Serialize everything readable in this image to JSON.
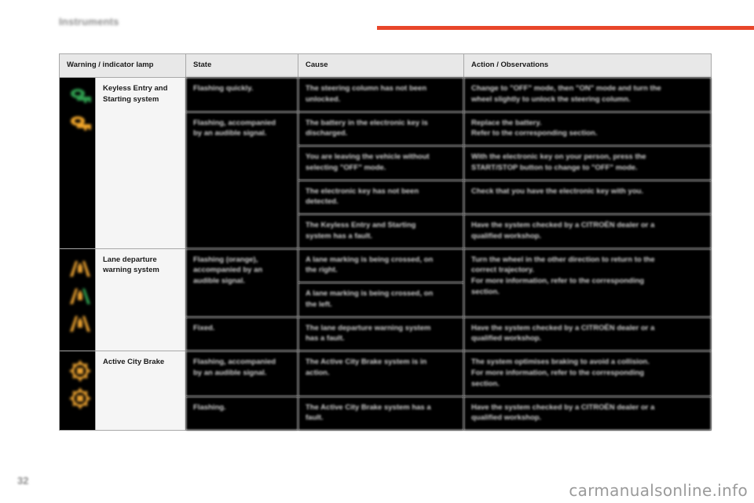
{
  "header": {
    "title": "Instruments",
    "accent_color": "#e8462a"
  },
  "footer": {
    "page_number": "32",
    "watermark": "carmanualsonline.info"
  },
  "table": {
    "columns": [
      "Warning / indicator lamp",
      "State",
      "Cause",
      "Action / Observations"
    ],
    "groups": [
      {
        "lamp": "Keyless Entry and Starting system",
        "icons": [
          "key-lamp-green-icon",
          "key-lamp-orange-icon"
        ],
        "rows": [
          {
            "state": [
              "Flashing quickly."
            ],
            "cause": [
              "The steering column has not been",
              "unlocked."
            ],
            "action": [
              "Change to \"OFF\" mode, then \"ON\" mode and turn the",
              "wheel slightly to unlock the steering column."
            ]
          },
          {
            "state": [
              "Flashing, accompanied",
              "by an audible signal."
            ],
            "cause": [
              "The battery in the electronic key is",
              "discharged."
            ],
            "action": [
              "Replace the battery.",
              "Refer to the corresponding section."
            ]
          },
          {
            "state": [],
            "cause": [
              "You are leaving the vehicle without",
              "selecting \"OFF\" mode."
            ],
            "action": [
              "With the electronic key on your person, press the",
              "START/STOP button to change to \"OFF\" mode."
            ]
          },
          {
            "state": [],
            "cause": [
              "The electronic key has not been",
              "detected."
            ],
            "action": [
              "Check that you have the electronic key with you."
            ]
          },
          {
            "state": [],
            "cause": [
              "The Keyless Entry and Starting",
              "system has a fault."
            ],
            "action": [
              "Have the system checked by a CITROËN dealer or a",
              "qualified workshop."
            ]
          }
        ]
      },
      {
        "lamp": "Lane departure warning system",
        "icons": [
          "lane-departure-lamp-1-icon",
          "lane-departure-lamp-2-icon",
          "lane-departure-lamp-3-icon"
        ],
        "rows": [
          {
            "state": [
              "Flashing (orange),",
              "accompanied by an",
              "audible signal."
            ],
            "cause": [
              "A lane marking is being crossed, on",
              "the right."
            ],
            "action": [
              "Turn the wheel in the other direction to return to the",
              "correct trajectory.",
              "For more information, refer to the corresponding",
              "section."
            ]
          },
          {
            "state": [],
            "cause": [
              "A lane marking is being crossed, on",
              "the left."
            ],
            "action": []
          },
          {
            "state": [
              "Fixed."
            ],
            "cause": [
              "The lane departure warning system",
              "has a fault."
            ],
            "action": [
              "Have the system checked by a CITROËN dealer or a",
              "qualified workshop."
            ]
          }
        ]
      },
      {
        "lamp": "Active City Brake",
        "icons": [
          "active-city-brake-lamp-1-icon",
          "active-city-brake-lamp-2-icon"
        ],
        "rows": [
          {
            "state": [
              "Flashing, accompanied",
              "by an audible signal."
            ],
            "cause": [
              "The Active City Brake system is in",
              "action."
            ],
            "action": [
              "The system optimises braking to avoid a collision.",
              "For more information, refer to the corresponding",
              "section."
            ]
          },
          {
            "state": [
              "Flashing."
            ],
            "cause": [
              "The Active City Brake system has a",
              "fault."
            ],
            "action": [
              "Have the system checked by a CITROËN dealer or a",
              "qualified workshop."
            ]
          }
        ]
      }
    ]
  }
}
